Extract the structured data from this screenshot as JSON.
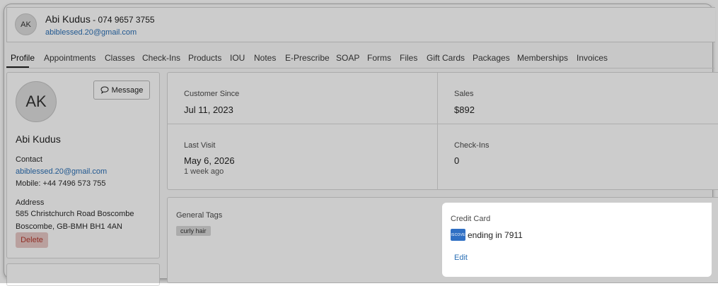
{
  "header": {
    "avatar_initials": "AK",
    "name": "Abi Kudus",
    "phone": " - 074 9657 3755",
    "email": "abiblessed.20@gmail.com"
  },
  "tabs": [
    {
      "label": "Profile",
      "active": true
    },
    {
      "label": "Appointments"
    },
    {
      "label": "Classes"
    },
    {
      "label": "Check-Ins"
    },
    {
      "label": "Products"
    },
    {
      "label": "IOU"
    },
    {
      "label": "Notes"
    },
    {
      "label": "E-Prescribe"
    },
    {
      "label": "SOAP"
    },
    {
      "label": "Forms"
    },
    {
      "label": "Files"
    },
    {
      "label": "Gift Cards"
    },
    {
      "label": "Packages"
    },
    {
      "label": "Memberships"
    },
    {
      "label": "Invoices"
    }
  ],
  "profile": {
    "initials": "AK",
    "message_label": "Message",
    "name": "Abi Kudus",
    "contact_label": "Contact",
    "email": "abiblessed.20@gmail.com",
    "mobile": "Mobile: +44 7496 573 755",
    "address_label": "Address",
    "address_line1": "585 Christchurch Road Boscombe",
    "address_line2": "Boscombe, GB-BMH BH1 4AN",
    "delete_label": "Delete"
  },
  "stats": {
    "customer_since_label": "Customer Since",
    "customer_since_value": "Jul 11, 2023",
    "sales_label": "Sales",
    "sales_value": "$892",
    "last_visit_label": "Last Visit",
    "last_visit_value": "May 6, 2026",
    "last_visit_sub": "1 week ago",
    "checkins_label": "Check-Ins",
    "checkins_value": "0"
  },
  "tags": {
    "title": "General Tags",
    "items": [
      "curly hair"
    ]
  },
  "credit_card": {
    "title": "Credit Card",
    "brand": "DISCOVER",
    "ending_text": "ending in 7911",
    "edit_label": "Edit"
  },
  "colors": {
    "link": "#2a6fb5",
    "delete_bg": "#e8c9c6",
    "delete_text": "#b53a2f",
    "discover_blue": "#2f6fc4"
  },
  "icons": {
    "message": "speech-bubble-icon",
    "card": "discover-card-icon"
  }
}
